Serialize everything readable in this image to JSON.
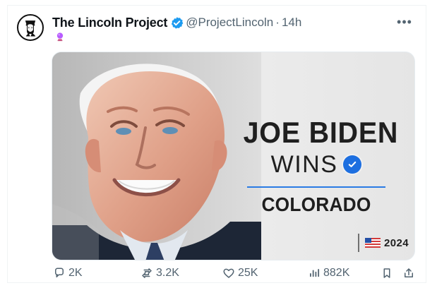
{
  "tweet": {
    "display_name": "The Lincoln Project",
    "handle": "@ProjectLincoln",
    "separator": "·",
    "time": "14h",
    "more_symbol": "•••",
    "emoji_name": "crystal-ball-icon"
  },
  "media": {
    "headline_line_1": "JOE BIDEN",
    "headline_line_2": "WINS",
    "state": "COLORADO",
    "year": "2024"
  },
  "actions": {
    "reply_count": "2K",
    "repost_count": "3.2K",
    "like_count": "25K",
    "views_count": "882K"
  },
  "colors": {
    "verified_blue": "#1d9bf0",
    "headline_blue": "#2a7be4",
    "text_primary": "#0f1419",
    "text_secondary": "#536471"
  }
}
